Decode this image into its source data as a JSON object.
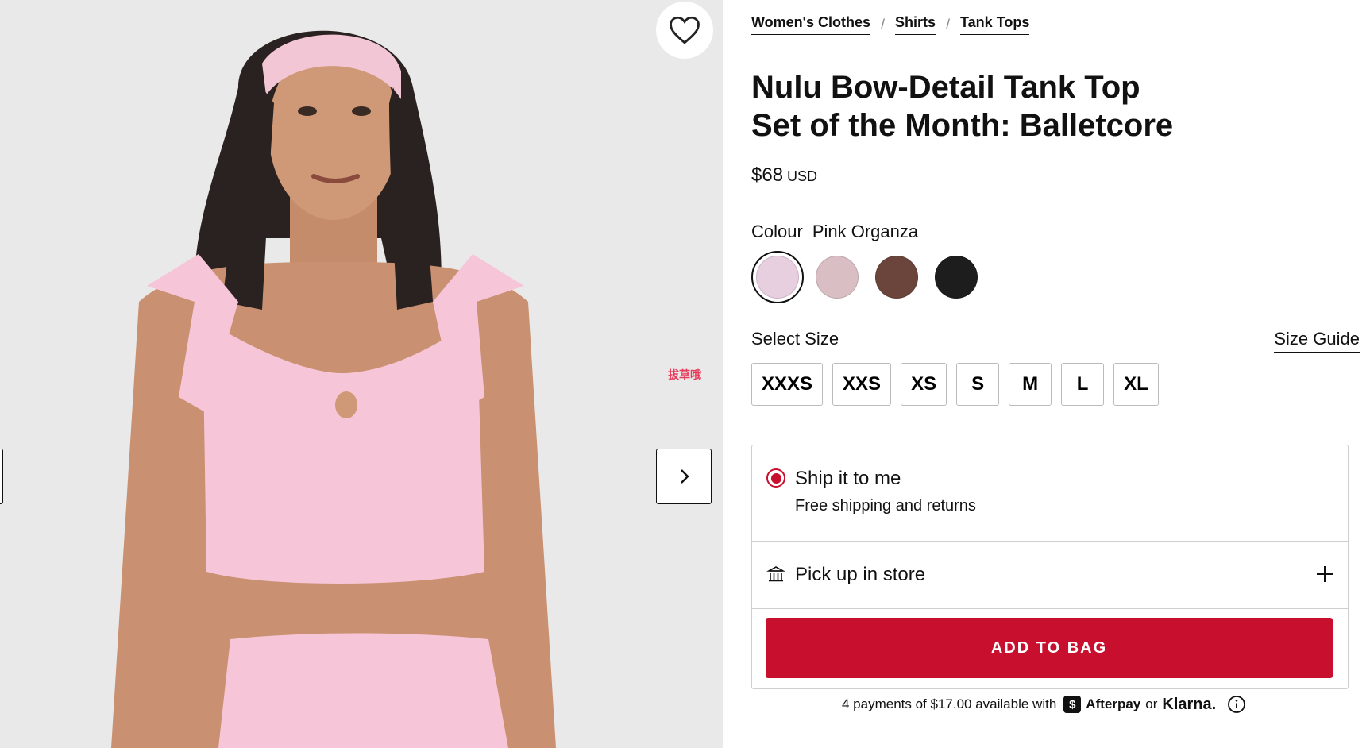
{
  "gallery": {
    "watermark": "拔草哦",
    "wishlist_icon": "heart-icon",
    "prev_icon": "chevron-left-icon",
    "next_icon": "chevron-right-icon",
    "photo_description": "product-photo"
  },
  "breadcrumbs": [
    "Women's Clothes",
    "Shirts",
    "Tank Tops"
  ],
  "product": {
    "title_line1": "Nulu Bow-Detail Tank Top",
    "title_line2": "Set of the Month: Balletcore",
    "price": "$68",
    "currency": "USD"
  },
  "colour": {
    "label": "Colour",
    "selected": "Pink Organza",
    "swatches": [
      {
        "name": "Pink Organza",
        "hex": "#e7cfe0"
      },
      {
        "name": "swatch-2",
        "hex": "#d9bfc4"
      },
      {
        "name": "swatch-3",
        "hex": "#6b453b"
      },
      {
        "name": "swatch-4",
        "hex": "#1d1d1d"
      }
    ]
  },
  "size": {
    "label": "Select Size",
    "guide": "Size Guide",
    "options": [
      "XXXS",
      "XXS",
      "XS",
      "S",
      "M",
      "L",
      "XL"
    ]
  },
  "delivery": {
    "ship_title": "Ship it to me",
    "ship_sub": "Free shipping and returns",
    "pickup_title": "Pick up in store"
  },
  "cta": {
    "add_to_bag": "ADD TO BAG"
  },
  "payment": {
    "prefix": "4 payments of $17.00 available with",
    "afterpay": "Afterpay",
    "afterpay_logo": "$",
    "or": "or",
    "klarna": "Klarna."
  },
  "colors": {
    "accent": "#c8102e",
    "photo_bg": "#e9e9e9",
    "garment": "#f6c6d8"
  }
}
